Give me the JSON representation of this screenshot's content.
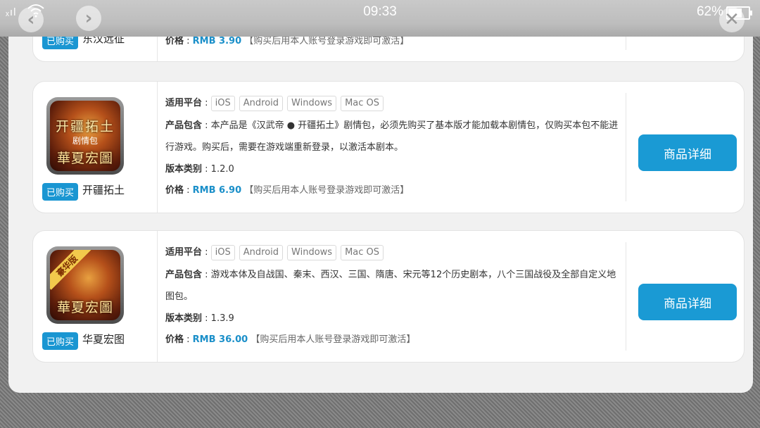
{
  "status": {
    "time": "09:33",
    "battery": "62%",
    "battery_level": 0.62
  },
  "labels": {
    "platform": "适用平台",
    "contents": "产品包含",
    "version": "版本类别",
    "price": "价格",
    "sep": " : ",
    "activate_note": "【购买后用本人账号登录游戏即可激活】",
    "detail_button": "商品详细",
    "purchased": "已购买"
  },
  "products": [
    {
      "name": "东汉远征",
      "price": "RMB 3.90"
    },
    {
      "name": "开疆拓土",
      "icon_title": "开疆拓土",
      "icon_sub": "剧情包",
      "icon_brand": "華夏宏圖",
      "platforms": [
        "iOS",
        "Android",
        "Windows",
        "Mac OS"
      ],
      "contents_line1": "本产品是《汉武帝 ● 开疆拓土》剧情包，必须先购买了基本版才能加载本剧情包，仅购买本包不能进",
      "contents_line2": "行游戏。购买后，需要在游戏端重新登录，以激活本剧本。",
      "version": "1.2.0",
      "price": "RMB 6.90"
    },
    {
      "name": "华夏宏图",
      "icon_ribbon": "豪华版",
      "icon_brand": "華夏宏圖",
      "platforms": [
        "iOS",
        "Android",
        "Windows",
        "Mac OS"
      ],
      "contents_line1": "游戏本体及自战国、秦末、西汉、三国、隋唐、宋元等12个历史剧本，八个三国战役及全部自定义地",
      "contents_line2": "图包。",
      "version": "1.3.9",
      "price": "RMB 36.00"
    }
  ]
}
